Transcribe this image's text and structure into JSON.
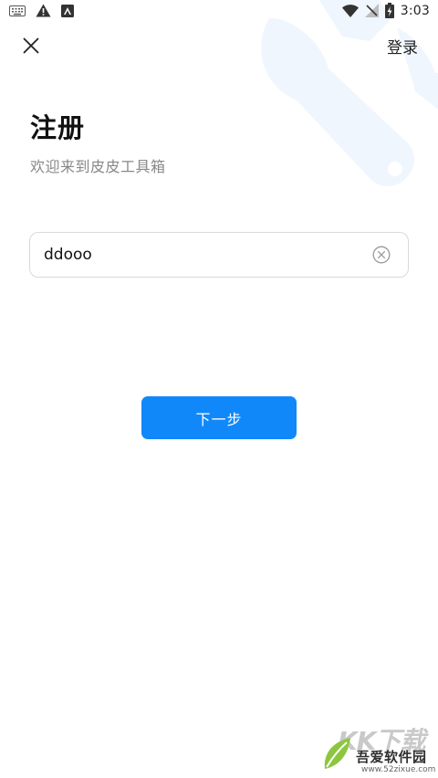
{
  "status_bar": {
    "time": "3:03",
    "icons": [
      "keyboard-icon",
      "warning-icon",
      "app-notification-icon",
      "wifi-icon",
      "no-signal-icon",
      "battery-charging-icon"
    ]
  },
  "header": {
    "close_icon": "close-icon",
    "login_label": "登录"
  },
  "page": {
    "title": "注册",
    "subtitle": "欢迎来到皮皮工具箱"
  },
  "form": {
    "username_value": "ddooo",
    "clear_icon": "clear-circle-icon",
    "next_label": "下一步"
  },
  "watermark": {
    "brand_text": "吾爱软件园",
    "url": "www.52zixue.com",
    "big_text": "KK下载"
  },
  "colors": {
    "accent": "#1188fa",
    "watermark_tint": "#f0f6fd"
  }
}
